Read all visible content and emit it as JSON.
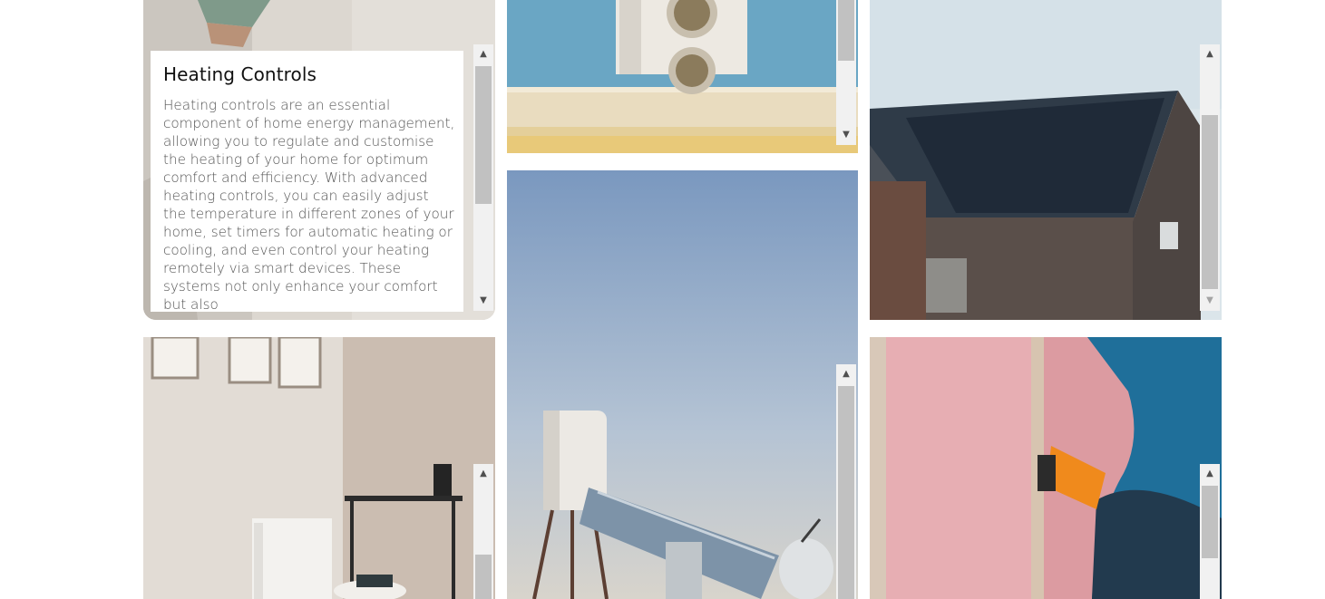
{
  "cards": [
    {
      "id": "heating-controls",
      "title": "Heating Controls",
      "description": "Heating controls are an essential component of home energy management, allowing you to regulate and customise the heating of your home for optimum comfort and efficiency. With advanced heating controls, you can easily adjust the temperature in different zones of your home, set timers for automatic heating or cooling, and even control your heating remotely via smart devices. These systems not only enhance your comfort but also"
    },
    {
      "id": "heat-pump",
      "image": "air-source-heat-pump-photo"
    },
    {
      "id": "solar-panels",
      "image": "solar-panel-roof-photo"
    },
    {
      "id": "electric-radiator",
      "image": "electric-radiator-room-photo"
    },
    {
      "id": "solar-water-heater",
      "image": "solar-water-heater-photo"
    },
    {
      "id": "insulation",
      "image": "wall-insulation-photo"
    }
  ],
  "scrollbar_icons": {
    "up": "triangle-up-icon",
    "down": "triangle-down-icon"
  }
}
